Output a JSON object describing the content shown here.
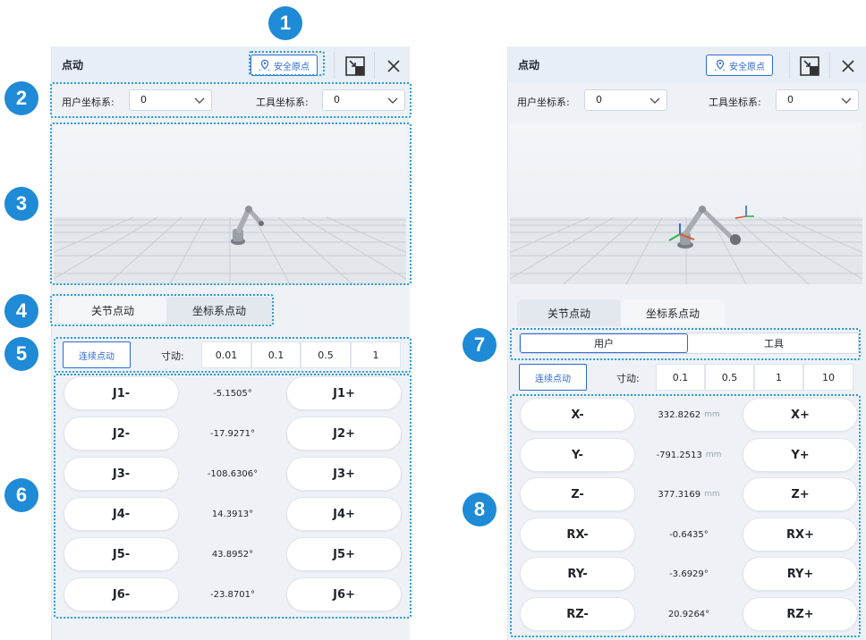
{
  "callouts": [
    "1",
    "2",
    "3",
    "4",
    "5",
    "6",
    "7",
    "8"
  ],
  "left": {
    "title": "点动",
    "safe_home": "安全原点",
    "user_coord_label": "用户坐标系:",
    "user_coord_value": "0",
    "tool_coord_label": "工具坐标系:",
    "tool_coord_value": "0",
    "tabs": [
      "关节点动",
      "坐标系点动"
    ],
    "continuous_label": "连续点动",
    "inch_label": "寸动:",
    "inch_options": [
      "0.01",
      "0.1",
      "0.5",
      "1"
    ],
    "rows": [
      {
        "minus": "J1-",
        "value": "-5.1505°",
        "plus": "J1+"
      },
      {
        "minus": "J2-",
        "value": "-17.9271°",
        "plus": "J2+"
      },
      {
        "minus": "J3-",
        "value": "-108.6306°",
        "plus": "J3+"
      },
      {
        "minus": "J4-",
        "value": "14.3913°",
        "plus": "J4+"
      },
      {
        "minus": "J5-",
        "value": "43.8952°",
        "plus": "J5+"
      },
      {
        "minus": "J6-",
        "value": "-23.8701°",
        "plus": "J6+"
      }
    ]
  },
  "right": {
    "title": "点动",
    "safe_home": "安全原点",
    "user_coord_label": "用户坐标系:",
    "user_coord_value": "0",
    "tool_coord_label": "工具坐标系:",
    "tool_coord_value": "0",
    "tabs": [
      "关节点动",
      "坐标系点动"
    ],
    "subtabs": [
      "用户",
      "工具"
    ],
    "continuous_label": "连续点动",
    "inch_label": "寸动:",
    "inch_options": [
      "0.1",
      "0.5",
      "1",
      "10"
    ],
    "rows": [
      {
        "minus": "X-",
        "value": "332.8262",
        "unit": "mm",
        "plus": "X+"
      },
      {
        "minus": "Y-",
        "value": "-791.2513",
        "unit": "mm",
        "plus": "Y+"
      },
      {
        "minus": "Z-",
        "value": "377.3169",
        "unit": "mm",
        "plus": "Z+"
      },
      {
        "minus": "RX-",
        "value": "-0.6435°",
        "unit": "",
        "plus": "RX+"
      },
      {
        "minus": "RY-",
        "value": "-3.6929°",
        "unit": "",
        "plus": "RY+"
      },
      {
        "minus": "RZ-",
        "value": "20.9264°",
        "unit": "",
        "plus": "RZ+"
      }
    ]
  },
  "colors": {
    "accent": "#2e6ad1",
    "callout": "#1f8ad6",
    "callout_border": "#2a9ad9"
  }
}
